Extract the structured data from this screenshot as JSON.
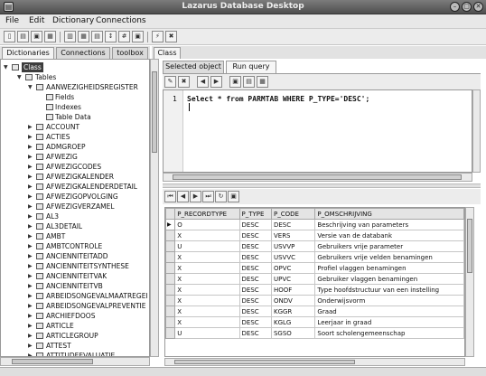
{
  "window": {
    "title": "Lazarus Database Desktop"
  },
  "menu": {
    "file": "File",
    "edit": "Edit",
    "dictionary": "Dictionary",
    "connections": "Connections"
  },
  "left_tabs": {
    "dictionaries": "Dictionaries",
    "connections": "Connections",
    "toolbox": "toolbox"
  },
  "right_tabs": {
    "class": "Class"
  },
  "inner_tabs": {
    "selected_object": "Selected object",
    "run_query": "Run query"
  },
  "tree": {
    "root": "Class",
    "tables": "Tables",
    "open_table": "AANWEZIGHEIDSREGISTER",
    "children": [
      "Fields",
      "Indexes",
      "Table Data"
    ],
    "items": [
      "ACCOUNT",
      "ACTIES",
      "ADMGROEP",
      "AFWEZIG",
      "AFWEZIGCODES",
      "AFWEZIGKALENDER",
      "AFWEZIGKALENDERDETAIL",
      "AFWEZIGOPVOLGING",
      "AFWEZIGVERZAMEL",
      "AL3",
      "AL3DETAIL",
      "AMBT",
      "AMBTCONTROLE",
      "ANCIENNITEITADD",
      "ANCIENNITEITSYNTHESE",
      "ANCIENNITEITVAK",
      "ANCIENNITEITVB",
      "ARBEIDSONGEVALMAATREGEI",
      "ARBEIDSONGEVALPREVENTIE",
      "ARCHIEFDOOS",
      "ARTICLE",
      "ARTICLEGROUP",
      "ATTEST",
      "ATTITUDEEVALUATIE"
    ]
  },
  "editor": {
    "line_number": "1",
    "sql": "Select * from PARMTAB WHERE P_TYPE='DESC';"
  },
  "grid": {
    "columns": [
      "P_RECORDTYPE",
      "P_TYPE",
      "P_CODE",
      "P_OMSCHRIJVING"
    ],
    "rows": [
      [
        "O",
        "DESC",
        "DESC",
        "Beschrijving van parameters"
      ],
      [
        "X",
        "DESC",
        "VERS",
        "Versie van de databank"
      ],
      [
        "U",
        "DESC",
        "USVVP",
        "Gebruikers vrije parameter"
      ],
      [
        "X",
        "DESC",
        "USVVC",
        "Gebruikers vrije velden benamingen"
      ],
      [
        "X",
        "DESC",
        "OPVC",
        "Profiel vlaggen benamingen"
      ],
      [
        "X",
        "DESC",
        "UPVC",
        "Gebruiker vlaggen benamingen"
      ],
      [
        "X",
        "DESC",
        "HOOF",
        "Type hoofdstructuur van een instelling"
      ],
      [
        "X",
        "DESC",
        "ONDV",
        "Onderwijsvorm"
      ],
      [
        "X",
        "DESC",
        "KGGR",
        "Graad"
      ],
      [
        "X",
        "DESC",
        "KGLG",
        "Leerjaar in graad"
      ],
      [
        "U",
        "DESC",
        "SGSO",
        "Soort scholengemeenschap"
      ]
    ]
  },
  "icons": {
    "new": "new-file-icon",
    "open": "open-file-icon",
    "save": "save-icon",
    "back": "arrow-left-icon",
    "forward": "arrow-right-icon"
  }
}
